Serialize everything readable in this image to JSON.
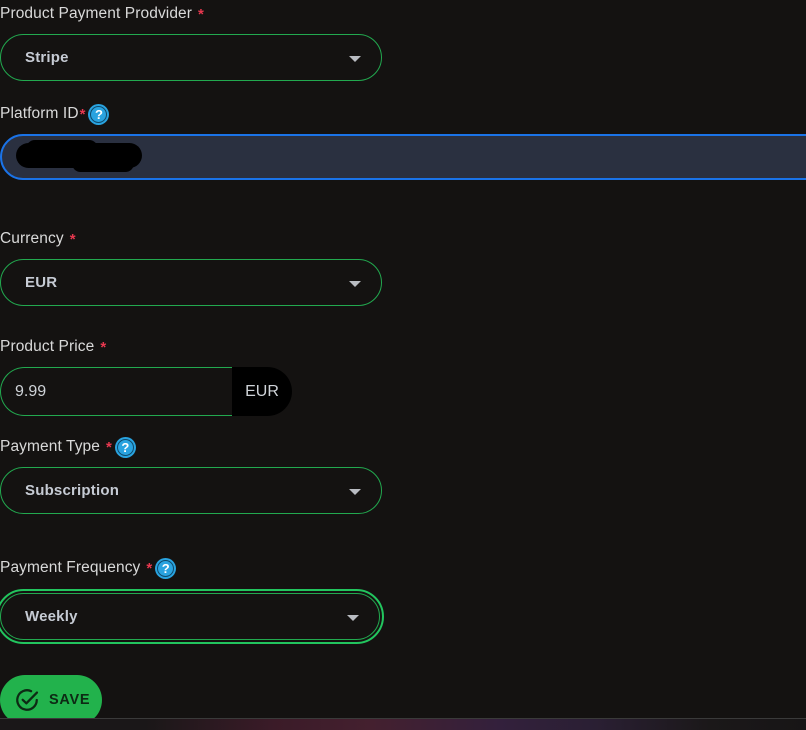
{
  "theme": {
    "background": "#141211",
    "accent_green": "#22a94f",
    "focus_blue": "#1a73e8",
    "input_fill": "#2a3040",
    "required_red": "#e8384f",
    "help_blue": "#29a3e0",
    "save_green": "#22b24c",
    "label_color": "#d9d9d9"
  },
  "form": {
    "provider": {
      "label": "Product Payment Prodvider",
      "required_mark": "*",
      "value": "Stripe",
      "caret_icon": "chevron-down-icon"
    },
    "platform_id": {
      "label": "Platform ID",
      "required_mark": "*",
      "help_icon": "help-circle-icon",
      "help_glyph": "?",
      "value": "",
      "state": "focused-redacted"
    },
    "currency": {
      "label": "Currency",
      "required_mark": "*",
      "value": "EUR",
      "caret_icon": "chevron-down-icon"
    },
    "product_price": {
      "label": "Product Price",
      "required_mark": "*",
      "value": "9.99",
      "suffix": "EUR"
    },
    "payment_type": {
      "label": "Payment Type",
      "required_mark": "*",
      "help_icon": "help-circle-icon",
      "help_glyph": "?",
      "value": "Subscription",
      "caret_icon": "chevron-down-icon"
    },
    "payment_frequency": {
      "label": "Payment Frequency",
      "required_mark": "*",
      "help_icon": "help-circle-icon",
      "help_glyph": "?",
      "value": "Weekly",
      "caret_icon": "chevron-down-icon",
      "state": "focused"
    }
  },
  "actions": {
    "save": {
      "label": "SAVE",
      "icon": "check-circle-icon"
    }
  }
}
